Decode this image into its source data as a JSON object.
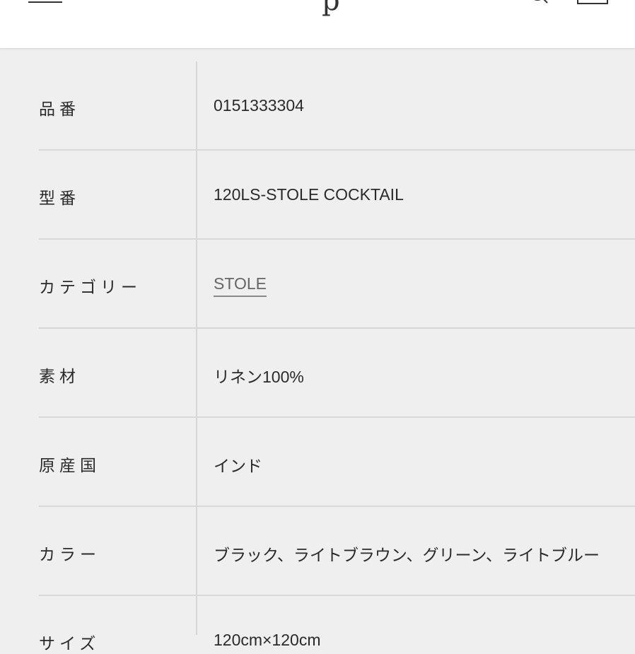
{
  "header": {
    "logo_fragment": "p"
  },
  "specs": [
    {
      "label": "品番",
      "value": "0151333304"
    },
    {
      "label": "型番",
      "value": "120LS-STOLE COCKTAIL"
    },
    {
      "label": "カテゴリー",
      "value": "STOLE",
      "is_link": true
    },
    {
      "label": "素材",
      "value": "リネン100%"
    },
    {
      "label": "原産国",
      "value": "インド"
    },
    {
      "label": "カラー",
      "value": "ブラック、ライトブラウン、グリーン、ライトブルー"
    },
    {
      "label": "サイズ",
      "value": "120cm×120cm"
    }
  ],
  "colors": {
    "background": "#efefef",
    "header_bg": "#ffffff",
    "divider": "#d8d8d8",
    "link": "#666666"
  }
}
